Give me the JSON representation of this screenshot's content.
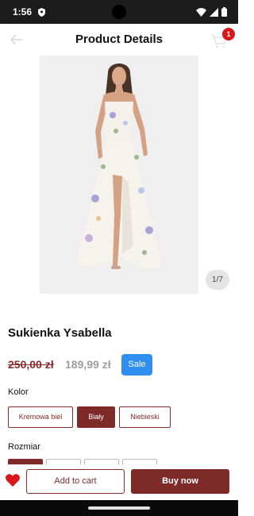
{
  "status_bar": {
    "time": "1:56"
  },
  "header": {
    "title": "Product Details",
    "cart_count": "1"
  },
  "gallery": {
    "counter": "1/7"
  },
  "product": {
    "name": "Sukienka Ysabella",
    "old_price": "250,00 zł",
    "new_price": "189,99 zł",
    "sale_badge": "Sale"
  },
  "color": {
    "label": "Kolor",
    "options": [
      "Kremowa biel",
      "Biały",
      "Niebieski"
    ],
    "selected": "Biały"
  },
  "size": {
    "label": "Rozmiar"
  },
  "actions": {
    "add_to_cart": "Add to cart",
    "buy_now": "Buy now"
  },
  "colors": {
    "accent": "#7d2a28",
    "sale": "#2f8ff0",
    "badge": "#d9161c",
    "heart": "#d9161c"
  }
}
